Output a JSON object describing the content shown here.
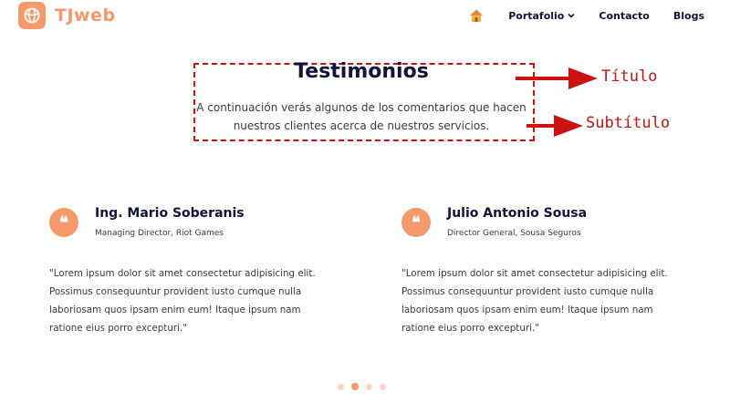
{
  "header": {
    "logo_text": "TJweb",
    "nav": {
      "portafolio": "Portafolio",
      "contacto": "Contacto",
      "blogs": "Blogs"
    }
  },
  "section": {
    "title": "Testimonios",
    "subtitle": "A continuación verás algunos de los comentarios que hacen nuestros clientes acerca de nuestros servicios."
  },
  "annotations": {
    "title_label": "Título",
    "subtitle_label": "Subtítulo"
  },
  "testimonials": [
    {
      "name": "Ing. Mario Soberanis",
      "role": "Managing Director, Riot Games",
      "quote_mark": "❝",
      "text": "\"Lorem ipsum dolor sit amet consectetur adipisicing elit. Possimus consequuntur provident iusto cumque nulla laboriosam quos ipsam enim eum! Itaque ipsum nam ratione eius porro excepturi.\""
    },
    {
      "name": "Julio Antonio Sousa",
      "role": "Director General, Sousa Seguros",
      "quote_mark": "❝",
      "text": "\"Lorem ipsum dolor sit amet consectetur adipisicing elit. Possimus consequuntur provident iusto cumque nulla laboriosam quos ipsam enim eum! Itaque ipsum nam ratione eius porro excepturi.\""
    }
  ],
  "carousel": {
    "dot_count": 4,
    "active_index": 1
  },
  "colors": {
    "accent": "#f6996b",
    "navy": "#13133b",
    "annotation_red": "#cc1111",
    "dot_inactive": "#fbd2c3"
  },
  "icons": {
    "logo": "basketball-icon",
    "home": "home-icon",
    "dropdown": "chevron-down-icon",
    "quote": "quote-icon"
  }
}
